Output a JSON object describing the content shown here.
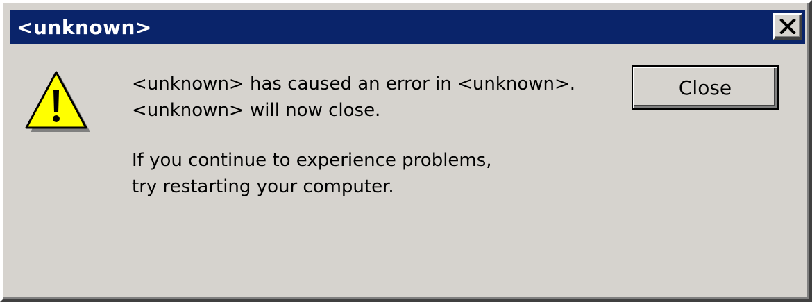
{
  "window": {
    "title": "<unknown>"
  },
  "titlebar": {
    "close_icon": "close-x-icon"
  },
  "dialog": {
    "icon": "warning-icon",
    "message_lines": [
      "<unknown> has caused an error in <unknown>.",
      "<unknown> will now close."
    ],
    "advice_lines": [
      "If you continue to experience problems,",
      "try restarting your computer."
    ],
    "close_button_label": "Close"
  },
  "colors": {
    "titlebar": "#0a246a",
    "face": "#d6d3ce",
    "warning_fill": "#ffff00"
  }
}
